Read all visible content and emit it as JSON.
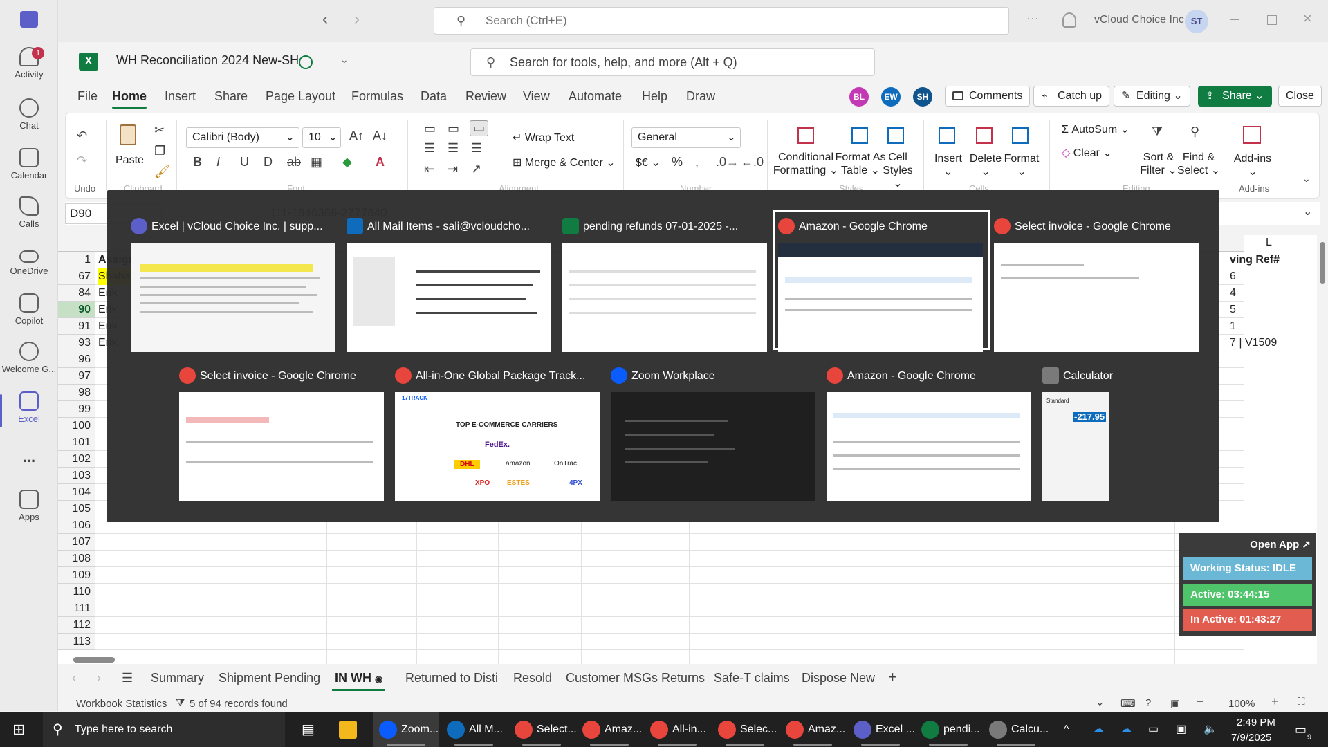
{
  "teams": {
    "search_placeholder": "Search (Ctrl+E)",
    "org": "vCloud Choice Inc.",
    "user_initials": "ST",
    "rail": [
      {
        "label": "Activity",
        "badge": "1"
      },
      {
        "label": "Chat"
      },
      {
        "label": "Calendar"
      },
      {
        "label": "Calls"
      },
      {
        "label": "OneDrive"
      },
      {
        "label": "Copilot"
      },
      {
        "label": "Welcome G..."
      },
      {
        "label": "Excel"
      },
      {
        "label": "..."
      },
      {
        "label": "Apps"
      }
    ]
  },
  "excel": {
    "workbook_title": "WH Reconciliation 2024 New-SH",
    "tool_search": "Search for tools, help, and more (Alt + Q)",
    "tabs": [
      "File",
      "Home",
      "Insert",
      "Share",
      "Page Layout",
      "Formulas",
      "Data",
      "Review",
      "View",
      "Automate",
      "Help",
      "Draw"
    ],
    "avatars": [
      {
        "initials": "BL",
        "color": "#c239b3"
      },
      {
        "initials": "EW",
        "color": "#0f6cbd"
      },
      {
        "initials": "SH",
        "color": "#0f548c"
      }
    ],
    "buttons": {
      "comments": "Comments",
      "catchup": "Catch up",
      "editing": "Editing",
      "share": "Share",
      "close": "Close"
    },
    "ribbon": {
      "undo_group": "Undo",
      "paste": "Paste",
      "clipboard_group": "Clipboard",
      "font_name": "Calibri (Body)",
      "font_size": "10",
      "font_group": "Font",
      "wrap_text": "Wrap Text",
      "merge_center": "Merge & Center",
      "alignment_group": "Alignment",
      "number_format": "General",
      "number_group": "Number",
      "currency": "$€",
      "conditional": [
        "Conditional",
        "Formatting"
      ],
      "format_table": [
        "Format As",
        "Table"
      ],
      "cell_styles": [
        "Cell",
        "Styles"
      ],
      "styles_group": "Styles",
      "insert": "Insert",
      "delete": "Delete",
      "format": "Format",
      "cells_group": "Cells",
      "autosum": "AutoSum",
      "clear": "Clear",
      "sort_filter": [
        "Sort &",
        "Filter"
      ],
      "find_select": [
        "Find &",
        "Select"
      ],
      "editing_group": "Editing",
      "addins": "Add-ins",
      "addins_group": "Add-ins"
    },
    "name_box": "D90",
    "formula": "111-1846366-2777840",
    "column_l": "L",
    "rows": [
      {
        "num": "1",
        "a": "Assign",
        "l": "ving Ref#"
      },
      {
        "num": "67",
        "a": "Shahav",
        "l": "6"
      },
      {
        "num": "84",
        "a": "Erik",
        "l": "4"
      },
      {
        "num": "90",
        "a": "Erik",
        "l": "5"
      },
      {
        "num": "91",
        "a": "Erik",
        "l": "1"
      },
      {
        "num": "93",
        "a": "Erik",
        "l": "7 | V1509"
      },
      {
        "num": "96"
      },
      {
        "num": "97"
      },
      {
        "num": "98"
      },
      {
        "num": "99"
      },
      {
        "num": "100"
      },
      {
        "num": "101"
      },
      {
        "num": "102"
      },
      {
        "num": "103"
      },
      {
        "num": "104"
      },
      {
        "num": "105"
      },
      {
        "num": "106"
      },
      {
        "num": "107"
      },
      {
        "num": "108"
      },
      {
        "num": "109"
      },
      {
        "num": "110"
      },
      {
        "num": "111"
      },
      {
        "num": "112"
      },
      {
        "num": "113"
      }
    ],
    "sheet_tabs": [
      "Summary",
      "Shipment Pending",
      "IN WH",
      "Returned to Disti",
      "Resold",
      "Customer MSGs Returns",
      "Safe-T claims",
      "Dispose New"
    ],
    "active_sheet": "IN WH",
    "status": {
      "stats": "Workbook Statistics",
      "filter": "5 of 94 records found",
      "zoom": "100%"
    }
  },
  "switcher": {
    "windows": [
      {
        "title": "Excel | vCloud Choice Inc. | supp...",
        "icon": "teams-icon",
        "color": "#5b5fc7"
      },
      {
        "title": "All Mail Items - sali@vcloudcho...",
        "icon": "outlook-icon",
        "color": "#0f6cbd"
      },
      {
        "title": "pending refunds 07-01-2025 -...",
        "icon": "excel-icon",
        "color": "#107c41"
      },
      {
        "title": "Amazon - Google Chrome",
        "icon": "chrome-icon",
        "color": "#e8453c"
      },
      {
        "title": "Select invoice - Google Chrome",
        "icon": "chrome-icon",
        "color": "#e8453c"
      },
      {
        "title": "Select invoice - Google Chrome",
        "icon": "chrome-icon",
        "color": "#e8453c"
      },
      {
        "title": "All-in-One Global Package Track...",
        "icon": "chrome-icon",
        "color": "#e8453c"
      },
      {
        "title": "Zoom Workplace",
        "icon": "zoom-icon",
        "color": "#0b5cff"
      },
      {
        "title": "Amazon - Google Chrome",
        "icon": "chrome-icon",
        "color": "#e8453c"
      },
      {
        "title": "Calculator",
        "icon": "calculator-icon",
        "color": "#7a7a7a"
      }
    ],
    "tracking_thumb": {
      "heading": "TOP E-COMMERCE CARRIERS",
      "brand": "17TRACK",
      "carriers": [
        "FedEx.",
        "DHL",
        "amazon",
        "OnTrac.",
        "XPO",
        "ESTES",
        "4PX"
      ]
    },
    "calculator": {
      "mode": "Standard",
      "display": "-217.95"
    }
  },
  "widget": {
    "open_app": "Open App ↗",
    "status": "Working Status: IDLE",
    "active": "Active: 03:44:15",
    "inactive": "In Active: 01:43:27"
  },
  "taskbar": {
    "search": "Type here to search",
    "apps": [
      {
        "label": "Zoom...",
        "color": "#0b5cff"
      },
      {
        "label": "All M...",
        "color": "#0f6cbd"
      },
      {
        "label": "Select...",
        "color": "#e8453c"
      },
      {
        "label": "Amaz...",
        "color": "#e8453c"
      },
      {
        "label": "All-in...",
        "color": "#e8453c"
      },
      {
        "label": "Selec...",
        "color": "#e8453c"
      },
      {
        "label": "Amaz...",
        "color": "#e8453c"
      },
      {
        "label": "Excel ...",
        "color": "#5b5fc7"
      },
      {
        "label": "pendi...",
        "color": "#107c41"
      },
      {
        "label": "Calcu...",
        "color": "#7a7a7a"
      }
    ],
    "time": "2:49 PM",
    "date": "7/9/2025",
    "notifications": "9"
  }
}
